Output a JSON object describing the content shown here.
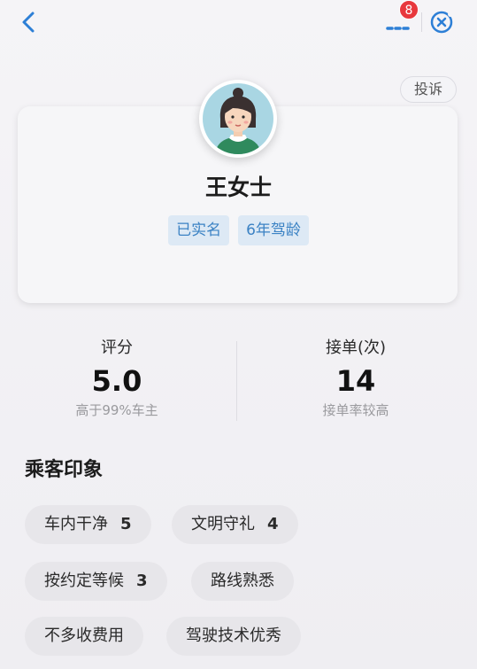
{
  "header": {
    "back_icon": "chevron-left-icon",
    "more_icon": "more-dots-icon",
    "badge_count": "8",
    "close_icon": "close-circle-icon",
    "report_label": "投诉"
  },
  "profile": {
    "avatar": "woman-avatar-illustration",
    "name": "王女士",
    "tags": [
      "已实名",
      "6年驾龄"
    ]
  },
  "stats": {
    "rating": {
      "label": "评分",
      "value": "5.0",
      "sub": "高于99%车主"
    },
    "orders": {
      "label": "接单(次)",
      "value": "14",
      "sub": "接单率较高"
    }
  },
  "impressions": {
    "title": "乘客印象",
    "items": [
      {
        "label": "车内干净",
        "count": "5"
      },
      {
        "label": "文明守礼",
        "count": "4"
      },
      {
        "label": "按约定等候",
        "count": "3"
      },
      {
        "label": "路线熟悉",
        "count": ""
      },
      {
        "label": "不多收费用",
        "count": ""
      },
      {
        "label": "驾驶技术优秀",
        "count": ""
      }
    ]
  },
  "colors": {
    "accent": "#3b82c4",
    "tag_bg": "#dde9f5",
    "badge": "#e8383d"
  }
}
